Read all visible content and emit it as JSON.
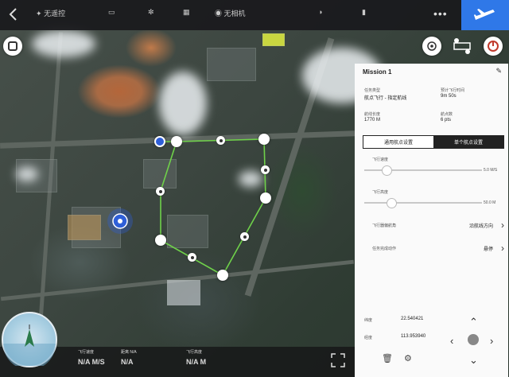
{
  "top_bar": {
    "items": [
      "无遥控",
      "",
      "",
      "",
      "",
      "无相机",
      "",
      ""
    ],
    "more_label": "•••"
  },
  "panel": {
    "title": "Mission 1",
    "task_type_label": "任务类型",
    "task_type_value": "航点飞行 - 指定航线",
    "flight_time_label": "预计飞行时间",
    "flight_time_value": "9m 50s",
    "route_length_label": "航线长度",
    "route_length_value": "1770 M",
    "waypoints_label": "航点数",
    "waypoints_value": "6 pts",
    "tab_general": "通用航点设置",
    "tab_single": "单个航点设置",
    "speed_label": "飞行速度",
    "speed_value": "5.0 M/S",
    "speed_fraction": 0.18,
    "altitude_label": "飞行高度",
    "altitude_value": "50.0 M",
    "altitude_fraction": 0.22,
    "heading_label": "飞行器偏航角",
    "heading_value": "沿航线方向",
    "action_label": "任务完成动作",
    "action_value": "悬停",
    "lat_label": "纬度",
    "lat_value": "22.540421",
    "lng_label": "经度",
    "lng_value": "113.953940"
  },
  "telemetry": {
    "speed_label": "飞行速度",
    "speed_value": "N/A M/S",
    "dist_label": "距离 N/A",
    "dist_value": "N/A",
    "alt_label": "飞行高度",
    "alt_value": "N/A M"
  },
  "colors": {
    "accent": "#2f78e8",
    "route": "#6fd14a",
    "home_marker": "#2f5fd8"
  },
  "icons": [
    "back-icon",
    "rc-icon",
    "takeoff-icon",
    "locate-icon",
    "route-icon",
    "record-icon",
    "chevron-up-icon",
    "chevron-down-icon",
    "chevron-left-icon",
    "chevron-right-icon",
    "trash-icon",
    "settings-icon",
    "pencil-icon",
    "fullscreen-icon"
  ]
}
